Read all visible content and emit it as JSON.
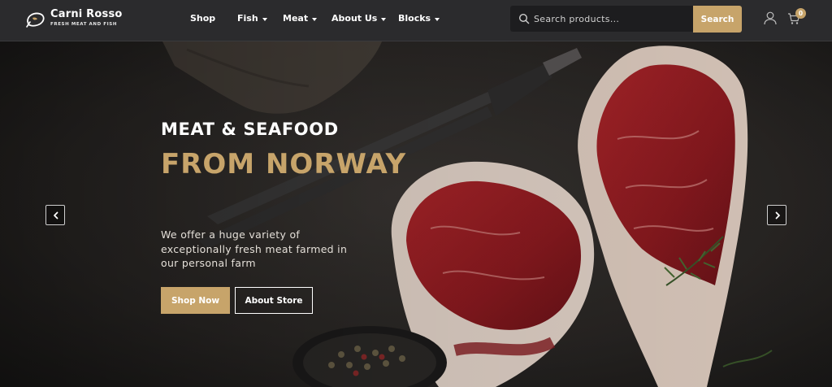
{
  "brand": {
    "name": "Carni Rosso",
    "tagline": "FRESH MEAT AND FISH"
  },
  "nav": [
    {
      "label": "Shop",
      "has_dropdown": false
    },
    {
      "label": "Fish",
      "has_dropdown": true
    },
    {
      "label": "Meat",
      "has_dropdown": true
    },
    {
      "label": "About Us",
      "has_dropdown": true
    },
    {
      "label": "Blocks",
      "has_dropdown": true
    }
  ],
  "search": {
    "placeholder": "Search products...",
    "value": "",
    "button_label": "Search",
    "icon": "search-icon"
  },
  "account": {
    "icon": "user-icon"
  },
  "cart": {
    "icon": "cart-icon",
    "count": "0"
  },
  "hero": {
    "subtitle": "MEAT & SEAFOOD",
    "title": "FROM NORWAY",
    "description": "We offer a huge variety of exceptionally fresh meat farmed in our personal farm",
    "primary_button": "Shop Now",
    "secondary_button": "About Store",
    "prev_icon": "chevron-left-icon",
    "next_icon": "chevron-right-icon"
  },
  "colors": {
    "accent": "#c7a46a",
    "header_bg": "#2b2b2d",
    "search_bg": "#1d1d1f"
  }
}
